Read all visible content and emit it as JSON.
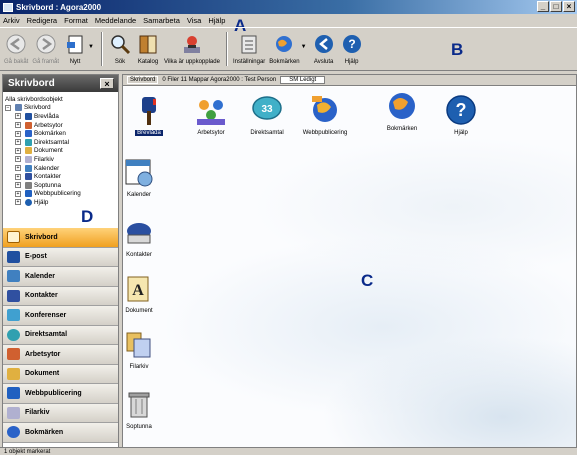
{
  "window": {
    "title": "Skrivbord : Agora2000",
    "controls": [
      "_",
      "□",
      "×"
    ]
  },
  "menu": [
    "Arkiv",
    "Redigera",
    "Format",
    "Meddelande",
    "Samarbeta",
    "Visa",
    "Hjälp"
  ],
  "toolbar": {
    "back": "Gå bakåt",
    "forward": "Gå framåt",
    "new": "Nytt",
    "search": "Sök",
    "catalog": "Katalog",
    "upload": "Vilka är uppkopplade",
    "settings": "Inställningar",
    "bookmarks": "Bokmärken",
    "quit": "Avsluta",
    "help": "Hjälp"
  },
  "callouts": {
    "a": "A",
    "b": "B",
    "c": "C",
    "d": "D"
  },
  "sidebar": {
    "title": "Skrivbord",
    "close": "×",
    "tree_root": "Alla skrivbordsobjekt",
    "tree": [
      "Skrivbord",
      "Brevlåda",
      "Arbetsytor",
      "Bokmärken",
      "Direktsamtal",
      "Dokument",
      "Filarkiv",
      "Kalender",
      "Kontakter",
      "Soptunna",
      "Webbpublicering",
      "Hjälp"
    ],
    "nav": [
      "Skrivbord",
      "E-post",
      "Kalender",
      "Kontakter",
      "Konferenser",
      "Direktsamtal",
      "Arbetsytor",
      "Dokument",
      "Webbpublicering",
      "Filarkiv",
      "Bokmärken"
    ]
  },
  "pathbar": {
    "location": "Skrivbord",
    "stats": "0 Filer  11 Mappar  Agora2000 : Test Person",
    "status": "SM Ledigt"
  },
  "desktop_icons": {
    "brevlada": "Brevlåda",
    "arbetsytor": "Arbetsytor",
    "direktsamtal": "Direktsamtal",
    "webbpublicering": "Webbpublicering",
    "bokmarken": "Bokmärken",
    "hjalp": "Hjälp",
    "kalender": "Kalender",
    "kontakter": "Kontakter",
    "dokument": "Dokument",
    "filarkiv": "Filarkiv",
    "soptunna": "Soptunna"
  },
  "status": {
    "text": "1 objekt markerat"
  },
  "colors": {
    "accent": "#0a246a",
    "active_nav": "#f0a020",
    "window": "#d4d0c8"
  }
}
